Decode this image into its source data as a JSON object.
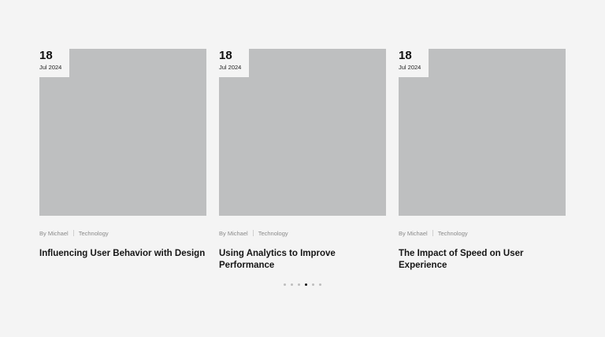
{
  "cards": [
    {
      "day": "18",
      "month": "Jul 2024",
      "author": "By Michael",
      "category": "Technology",
      "title": "Influencing User Behavior with Design"
    },
    {
      "day": "18",
      "month": "Jul 2024",
      "author": "By Michael",
      "category": "Technology",
      "title": "Using Analytics to Improve Performance"
    },
    {
      "day": "18",
      "month": "Jul 2024",
      "author": "By Michael",
      "category": "Technology",
      "title": "The Impact of Speed on User Experience"
    }
  ],
  "pagination": {
    "total": 6,
    "active_index": 3
  },
  "colors": {
    "background": "#f4f4f4",
    "placeholder_image": "#bebfc0",
    "dot_active": "#111111",
    "dot_inactive": "#bdbdbd"
  }
}
